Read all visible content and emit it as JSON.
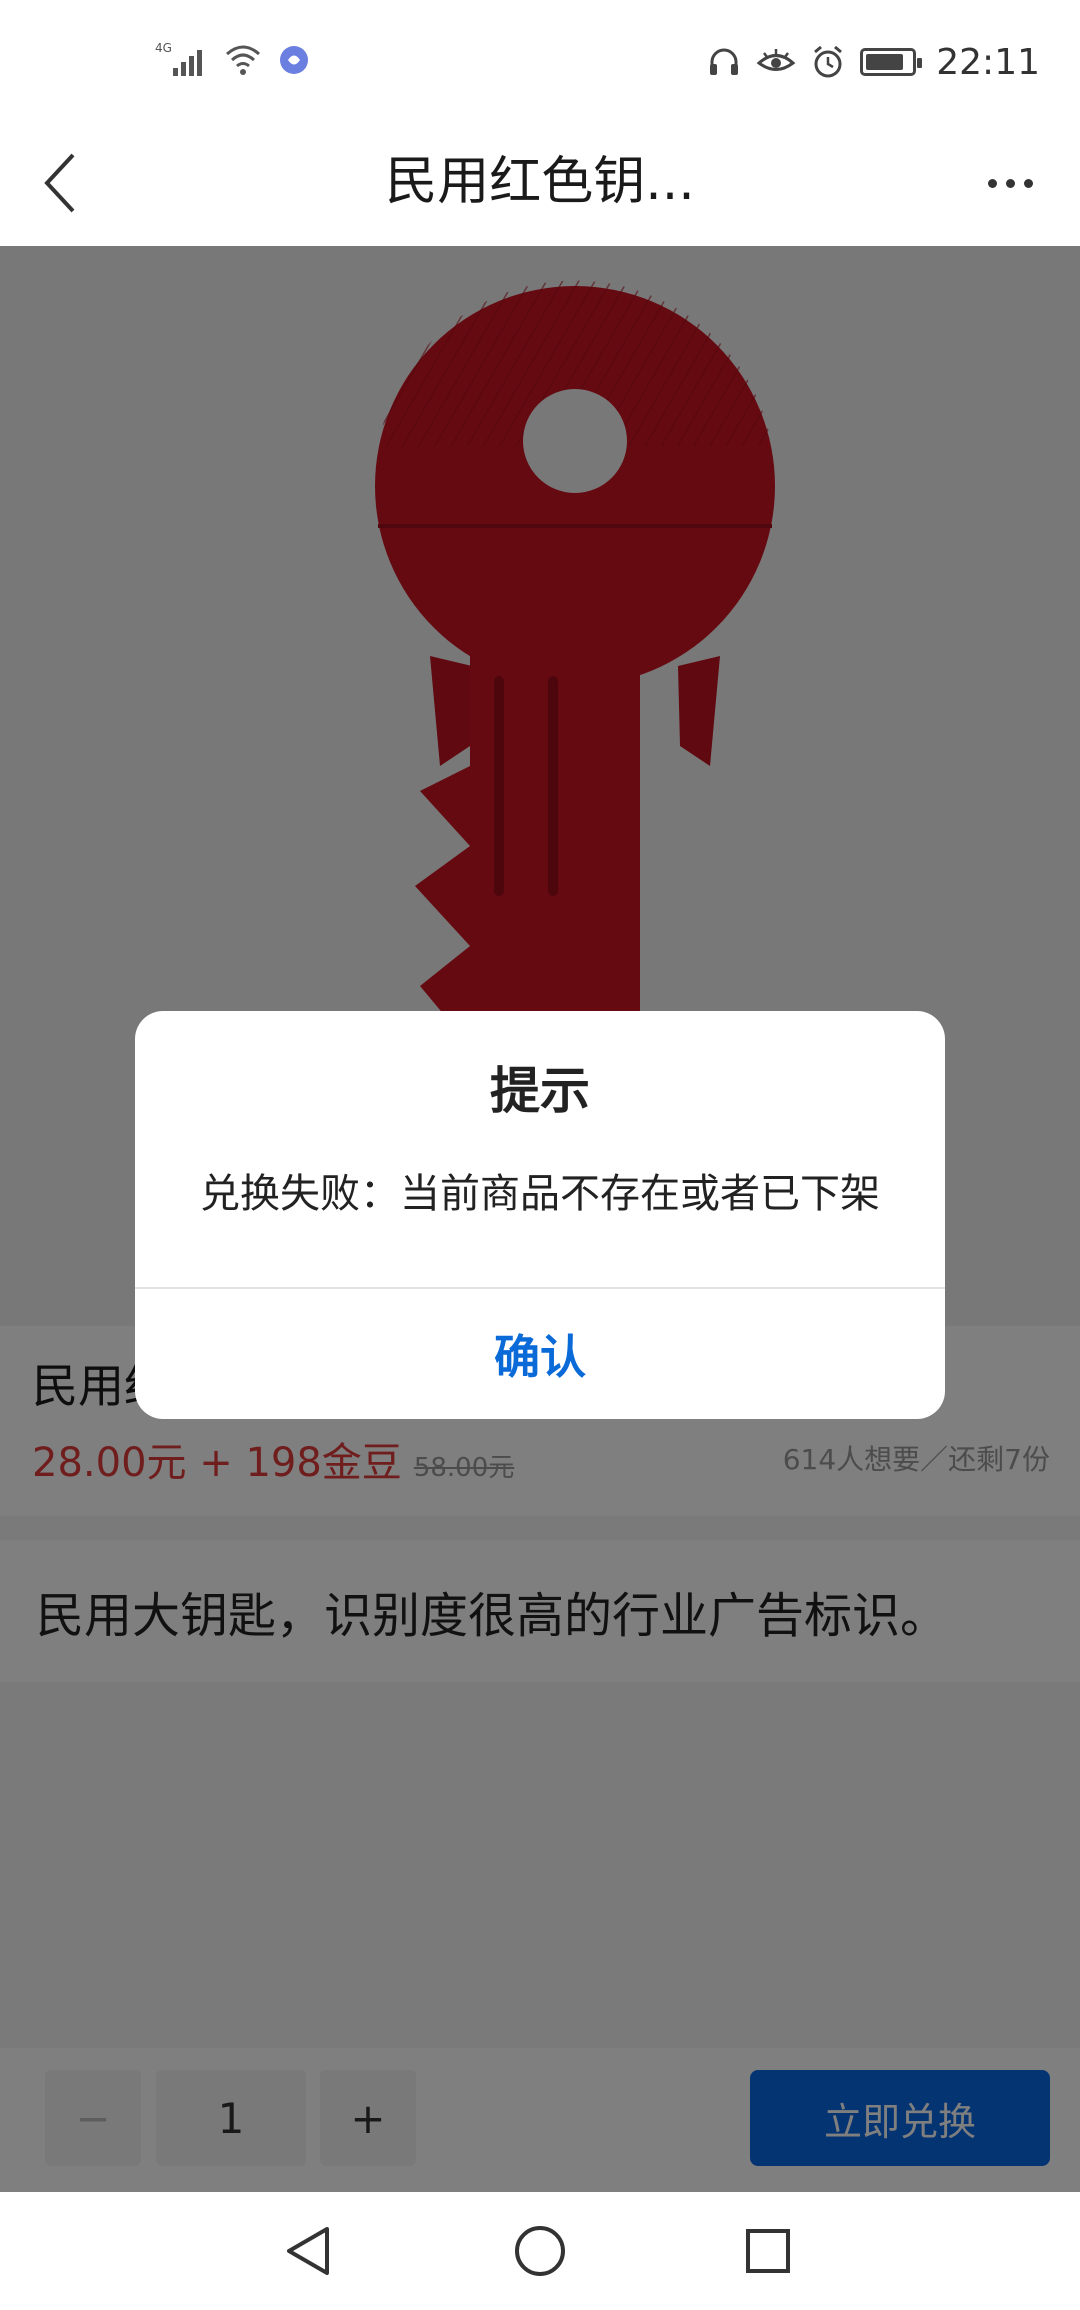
{
  "status_bar": {
    "network_label": "4G",
    "time": "22:11",
    "battery_level": 0.85,
    "icons": [
      "signal-icon",
      "wifi-icon",
      "app-notification-icon",
      "headphones-icon",
      "eye-comfort-icon",
      "alarm-icon",
      "battery-icon"
    ]
  },
  "nav": {
    "title": "民用红色钥..."
  },
  "product": {
    "name": "民用红色钥匙",
    "price": "28.00元 + 198金豆",
    "original_price": "58.00元",
    "want_stock": "614人想要／还剩7份",
    "description": "民用大钥匙，识别度很高的行业广告标识。"
  },
  "bottom_bar": {
    "minus_label": "−",
    "quantity": "1",
    "plus_label": "+",
    "redeem_label": "立即兑换"
  },
  "dialog": {
    "title": "提示",
    "message": "兑换失败：当前商品不存在或者已下架",
    "confirm_label": "确认"
  },
  "colors": {
    "price_red": "#e03a3a",
    "action_blue": "#0a69e6",
    "confirm_blue": "#0a6ad8",
    "key_red": "#cc1424"
  }
}
